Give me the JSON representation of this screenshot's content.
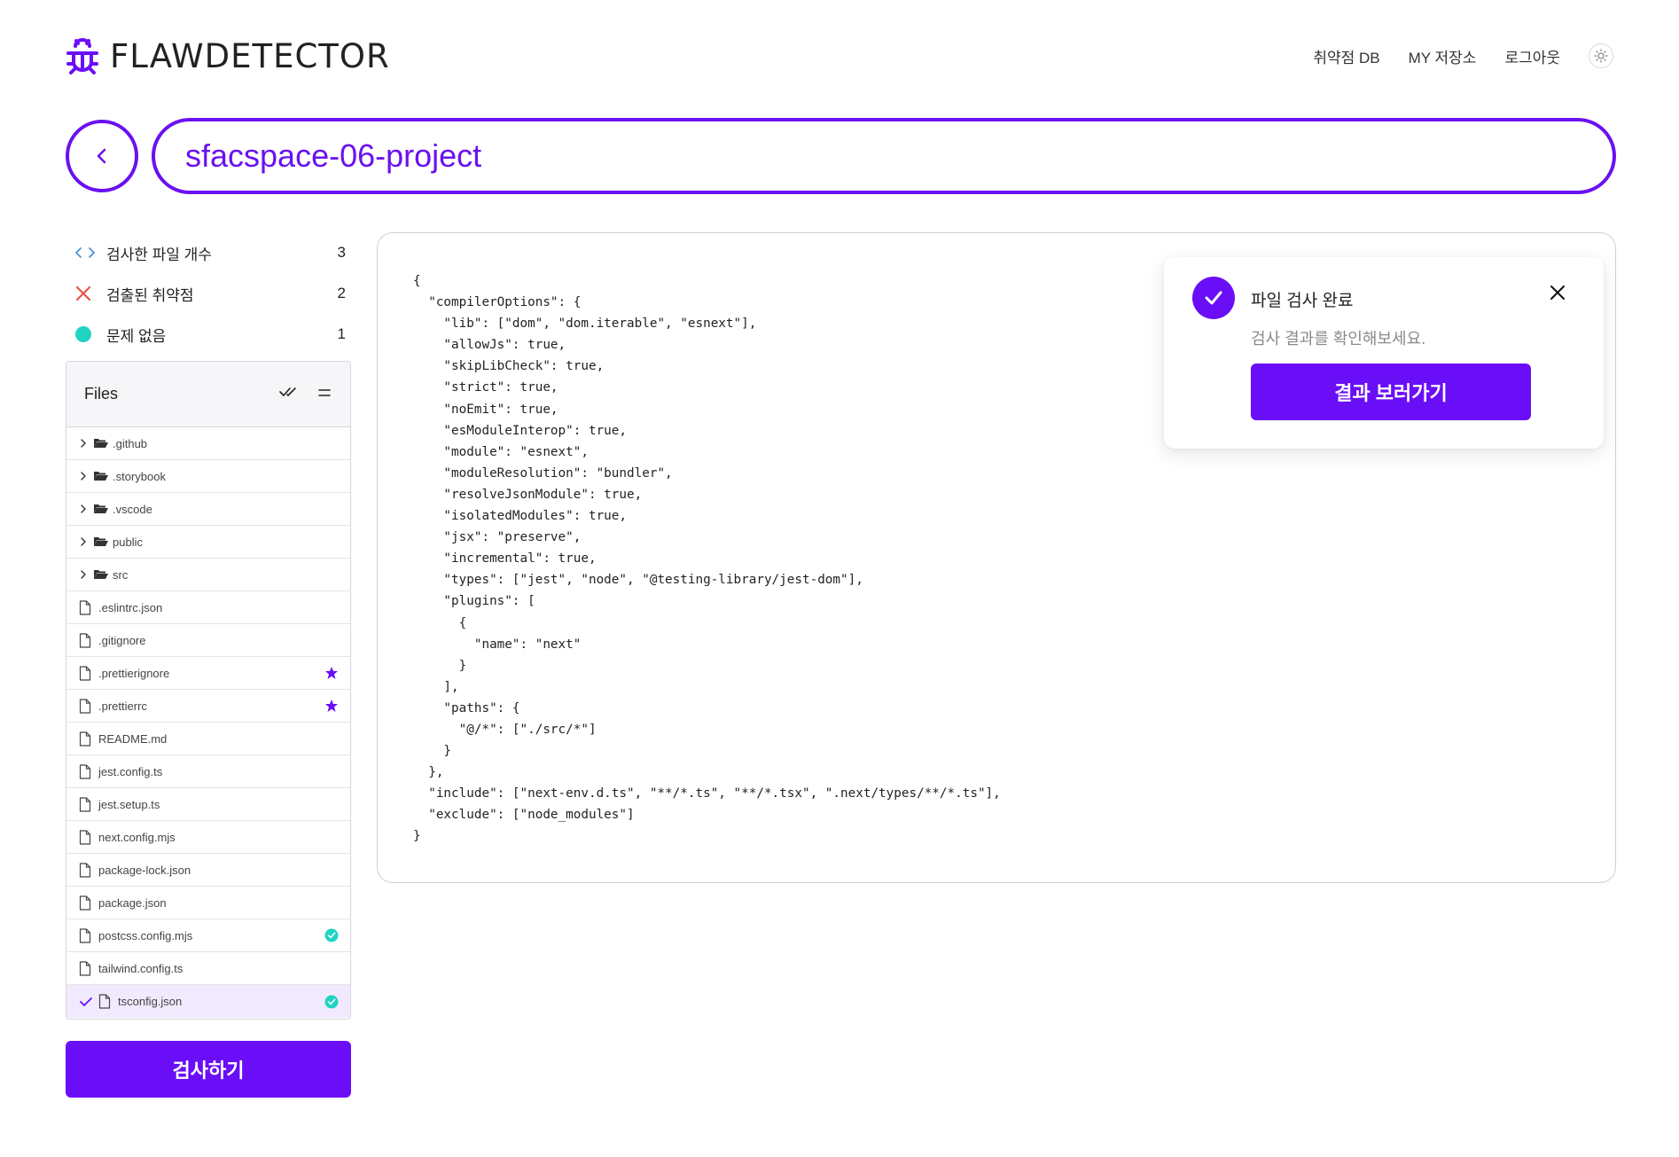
{
  "brand": {
    "name": "FLAWDETECTOR",
    "accent": "#6a0ef7"
  },
  "nav": {
    "items": [
      "취약점 DB",
      "MY 저장소",
      "로그아웃"
    ],
    "theme_icon": "sun-icon"
  },
  "project": {
    "name": "sfacspace-06-project",
    "back_icon": "chevron-left-icon"
  },
  "stats": [
    {
      "label": "검사한 파일 개수",
      "count": "3",
      "icon": "code-brackets-icon"
    },
    {
      "label": "검출된 취약점",
      "count": "2",
      "icon": "x-icon"
    },
    {
      "label": "문제 없음",
      "count": "1",
      "icon": "teal-dot-icon"
    }
  ],
  "files": {
    "title": "Files",
    "tools": [
      "double-check-icon",
      "collapse-icon"
    ],
    "items": [
      {
        "name": ".github",
        "type": "folder",
        "badge": ""
      },
      {
        "name": ".storybook",
        "type": "folder",
        "badge": ""
      },
      {
        "name": ".vscode",
        "type": "folder",
        "badge": ""
      },
      {
        "name": "public",
        "type": "folder",
        "badge": ""
      },
      {
        "name": "src",
        "type": "folder",
        "badge": ""
      },
      {
        "name": ".eslintrc.json",
        "type": "file",
        "badge": ""
      },
      {
        "name": ".gitignore",
        "type": "file",
        "badge": ""
      },
      {
        "name": ".prettierignore",
        "type": "file",
        "badge": "star"
      },
      {
        "name": ".prettierrc",
        "type": "file",
        "badge": "star"
      },
      {
        "name": "README.md",
        "type": "file",
        "badge": ""
      },
      {
        "name": "jest.config.ts",
        "type": "file",
        "badge": ""
      },
      {
        "name": "jest.setup.ts",
        "type": "file",
        "badge": ""
      },
      {
        "name": "next.config.mjs",
        "type": "file",
        "badge": ""
      },
      {
        "name": "package-lock.json",
        "type": "file",
        "badge": ""
      },
      {
        "name": "package.json",
        "type": "file",
        "badge": ""
      },
      {
        "name": "postcss.config.mjs",
        "type": "file",
        "badge": "ok"
      },
      {
        "name": "tailwind.config.ts",
        "type": "file",
        "badge": ""
      },
      {
        "name": "tsconfig.json",
        "type": "file",
        "badge": "ok",
        "selected": true
      }
    ]
  },
  "scan_button": "검사하기",
  "code": "{\n  \"compilerOptions\": {\n    \"lib\": [\"dom\", \"dom.iterable\", \"esnext\"],\n    \"allowJs\": true,\n    \"skipLibCheck\": true,\n    \"strict\": true,\n    \"noEmit\": true,\n    \"esModuleInterop\": true,\n    \"module\": \"esnext\",\n    \"moduleResolution\": \"bundler\",\n    \"resolveJsonModule\": true,\n    \"isolatedModules\": true,\n    \"jsx\": \"preserve\",\n    \"incremental\": true,\n    \"types\": [\"jest\", \"node\", \"@testing-library/jest-dom\"],\n    \"plugins\": [\n      {\n        \"name\": \"next\"\n      }\n    ],\n    \"paths\": {\n      \"@/*\": [\"./src/*\"]\n    }\n  },\n  \"include\": [\"next-env.d.ts\", \"**/*.ts\", \"**/*.tsx\", \".next/types/**/*.ts\"],\n  \"exclude\": [\"node_modules\"]\n}",
  "toast": {
    "title": "파일 검사 완료",
    "message": "검사 결과를 확인해보세요.",
    "button": "결과 보러가기"
  }
}
